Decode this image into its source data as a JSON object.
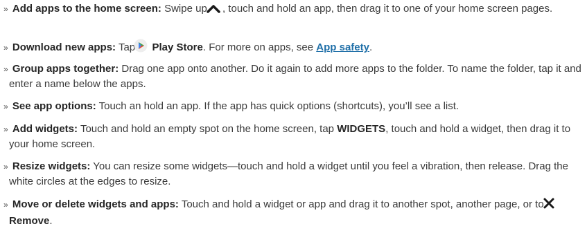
{
  "bullet": "»",
  "items": [
    {
      "title": "Add apps to the home screen:",
      "t1": "Swipe up",
      "icon": "chevron-up-icon",
      "t2": ", touch and hold an app, then drag it to one of your home screen pages."
    },
    {
      "title": "Download new apps:",
      "t1": "Tap",
      "icon": "play-store-icon",
      "app": "Play Store",
      "t2": ". For more on apps, see",
      "link": "App safety",
      "t3": "."
    },
    {
      "title": "Group apps together:",
      "t1": "Drag one app onto another. Do it again to add more apps to the folder. To name the folder, tap it and enter a name below the apps."
    },
    {
      "title": "See app options:",
      "t1": "Touch an hold an app. If the app has quick options (shortcuts), you’ll see a list."
    },
    {
      "title": "Add widgets:",
      "t1": "Touch and hold an empty spot on the home screen, tap",
      "bold": "WIDGETS",
      "t2": ", touch and hold a widget, then drag it to your home screen."
    },
    {
      "title": "Resize widgets:",
      "t1": "You can resize some widgets—touch and hold a widget until you feel a vibration, then release. Drag the white circles at the edges to resize."
    },
    {
      "title": "Move or delete widgets and apps:",
      "t1": "Touch and hold a widget or app and drag it to another spot, another page, or to",
      "icon": "close-x-icon",
      "bold": "Remove",
      "t2": "."
    }
  ],
  "colors": {
    "text": "#3a3a3a",
    "link": "#1f6fa8",
    "play_orange": "#f5a623"
  }
}
